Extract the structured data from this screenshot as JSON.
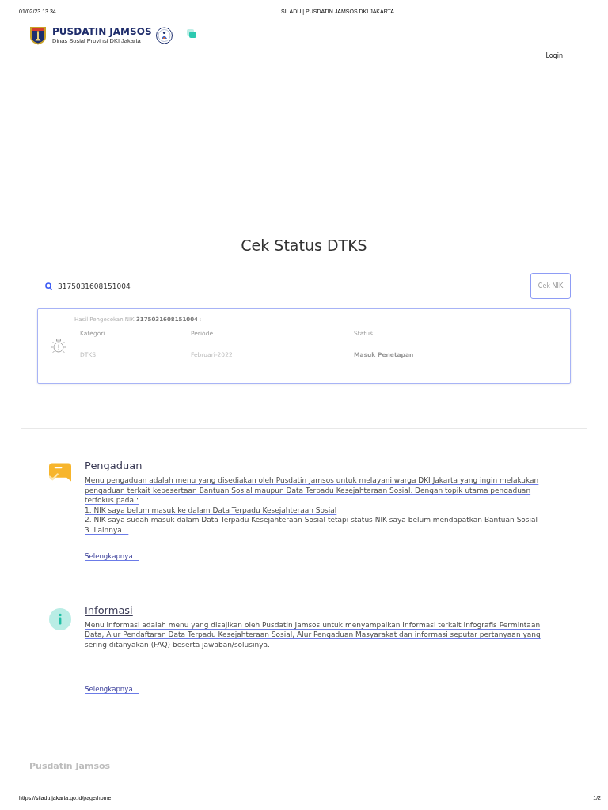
{
  "print_header": {
    "datetime": "01/02/23 13.34",
    "title": "SILADU | PUSDATIN JAMSOS DKI JAKARTA"
  },
  "brand": {
    "name": "PUSDATIN JAMSOS",
    "subtitle": "Dinas Sosial Provinsi DKI Jakarta"
  },
  "nav": {
    "login": "Login"
  },
  "nik_check": {
    "title": "Cek Status DTKS",
    "nik_input": {
      "value": "3175031608151004"
    },
    "button": "Cek NIK",
    "result": {
      "caption": "Hasil Pengecekan NIK **3175031608151004** :",
      "columns": [
        "Kategori",
        "Periode",
        "Status"
      ],
      "rows": [
        [
          "DTKS",
          "Februari-2022",
          "Masuk Penetapan"
        ]
      ]
    }
  },
  "menus": [
    {
      "kind": "complaint",
      "title": "Pengaduan",
      "description": "Menu pengaduan adalah menu yang disediakan oleh Pusdatin Jamsos untuk melayani warga DKI Jakarta yang ingin melakukan pengaduan terkait kepesertaan Bantuan Sosial maupun Data Terpadu Kesejahteraan Sosial. Dengan topik utama pengaduan terfokus pada :",
      "items": [
        "1. NIK saya belum masuk ke dalam Data Terpadu Kesejahteraan Sosial",
        "2. NIK saya sudah masuk dalam Data Terpadu Kesejahteraan Sosial tetapi status NIK saya belum mendapatkan Bantuan Sosial",
        "3. Lainnya..."
      ],
      "more": "Selengkapnya..."
    },
    {
      "kind": "info",
      "title": "Informasi",
      "description": "Menu informasi adalah menu yang disajikan oleh Pusdatin Jamsos untuk menyampaikan Informasi terkait Infografis Permintaan Data, Alur Pendaftaran Data Terpadu Kesejahteraan Sosial, Alur Pengaduan Masyarakat dan informasi seputar pertanyaan yang sering ditanyakan (FAQ) beserta jawaban/solusinya.",
      "more": "Selengkapnya..."
    }
  ],
  "footer": {
    "brand": "Pusdatin Jamsos"
  },
  "print_footer": {
    "url": "https://siladu.jakarta.go.id/page/home",
    "page": "1/2"
  }
}
